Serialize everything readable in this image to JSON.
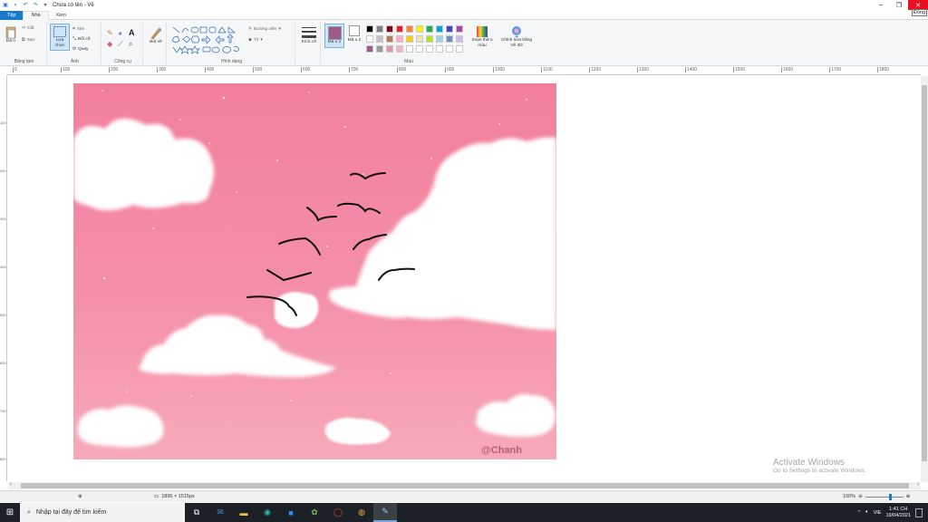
{
  "window": {
    "title": "Chưa có tên - Vẽ",
    "close_tooltip": "Đóng"
  },
  "tabs": [
    {
      "label": "Tệp"
    },
    {
      "label": "Nhà"
    },
    {
      "label": "Xem"
    }
  ],
  "ribbon": {
    "clipboard": {
      "paste_label": "Dá n",
      "cut_label": "Cắt",
      "copy_label": "Sao",
      "group_label": "Bảng tạm"
    },
    "image": {
      "select_label": "Lựa chọn",
      "crop_label": "Xén",
      "resize_label": "Đổi cỡ",
      "rotate_label": "Quay",
      "group_label": "Ảnh"
    },
    "tools": {
      "group_label": "Công cụ"
    },
    "brushes": {
      "label": "Bút vẽ"
    },
    "shapes": {
      "outline_label": "Đường viền",
      "fill_label": "Tô",
      "group_label": "Hình dạng"
    },
    "size": {
      "label": "Kích cỡ"
    },
    "colors": {
      "color1_label": "Mà u 1",
      "color2_label": "Mà u 2",
      "edit_colors_label": "Soạn thả o màu",
      "paint3d_label": "Chỉnh sửa bằng Vẽ 3D",
      "group_label": "Màu",
      "color1": "#9b5d85",
      "color2": "#ffffff",
      "palette_row1": [
        "#000000",
        "#7f7f7f",
        "#880015",
        "#ed1c24",
        "#ff7f27",
        "#fff200",
        "#22b14c",
        "#00a2e8",
        "#3f48cc",
        "#a349a4"
      ],
      "palette_row2": [
        "#ffffff",
        "#c3c3c3",
        "#b97a57",
        "#ffaec9",
        "#ffc90e",
        "#efe4b0",
        "#b5e61d",
        "#99d9ea",
        "#7092be",
        "#c8bfe7"
      ],
      "palette_row3": [
        "#a05a8c",
        "#9c9c9c",
        "#e098b0",
        "#f3b8c8",
        "#ffffff",
        "#ffffff",
        "#ffffff",
        "#ffffff",
        "#ffffff",
        "#ffffff"
      ]
    }
  },
  "ruler": {
    "top_ticks": [
      "0",
      "100",
      "200",
      "300",
      "400",
      "500",
      "600",
      "700",
      "800",
      "900",
      "1000",
      "1100",
      "1200",
      "1300",
      "1400",
      "1500",
      "1600",
      "1700",
      "1800"
    ],
    "left_ticks": [
      "100",
      "200",
      "300",
      "400",
      "500",
      "600",
      "700",
      "800"
    ]
  },
  "canvas": {
    "watermark": "@Chanh",
    "sky_top": "#f27f9c",
    "sky_bottom": "#f6a3b4"
  },
  "activation": {
    "line1": "Activate Windows",
    "line2": "Go to Settings to activate Windows."
  },
  "statusbar": {
    "dimensions": "1895 × 1515px",
    "zoom": "100%"
  },
  "taskbar": {
    "search_placeholder": "Nhập tại đây để tìm kiếm",
    "language": "VIE",
    "time": "1:41 CH",
    "date": "19/04/2021"
  }
}
